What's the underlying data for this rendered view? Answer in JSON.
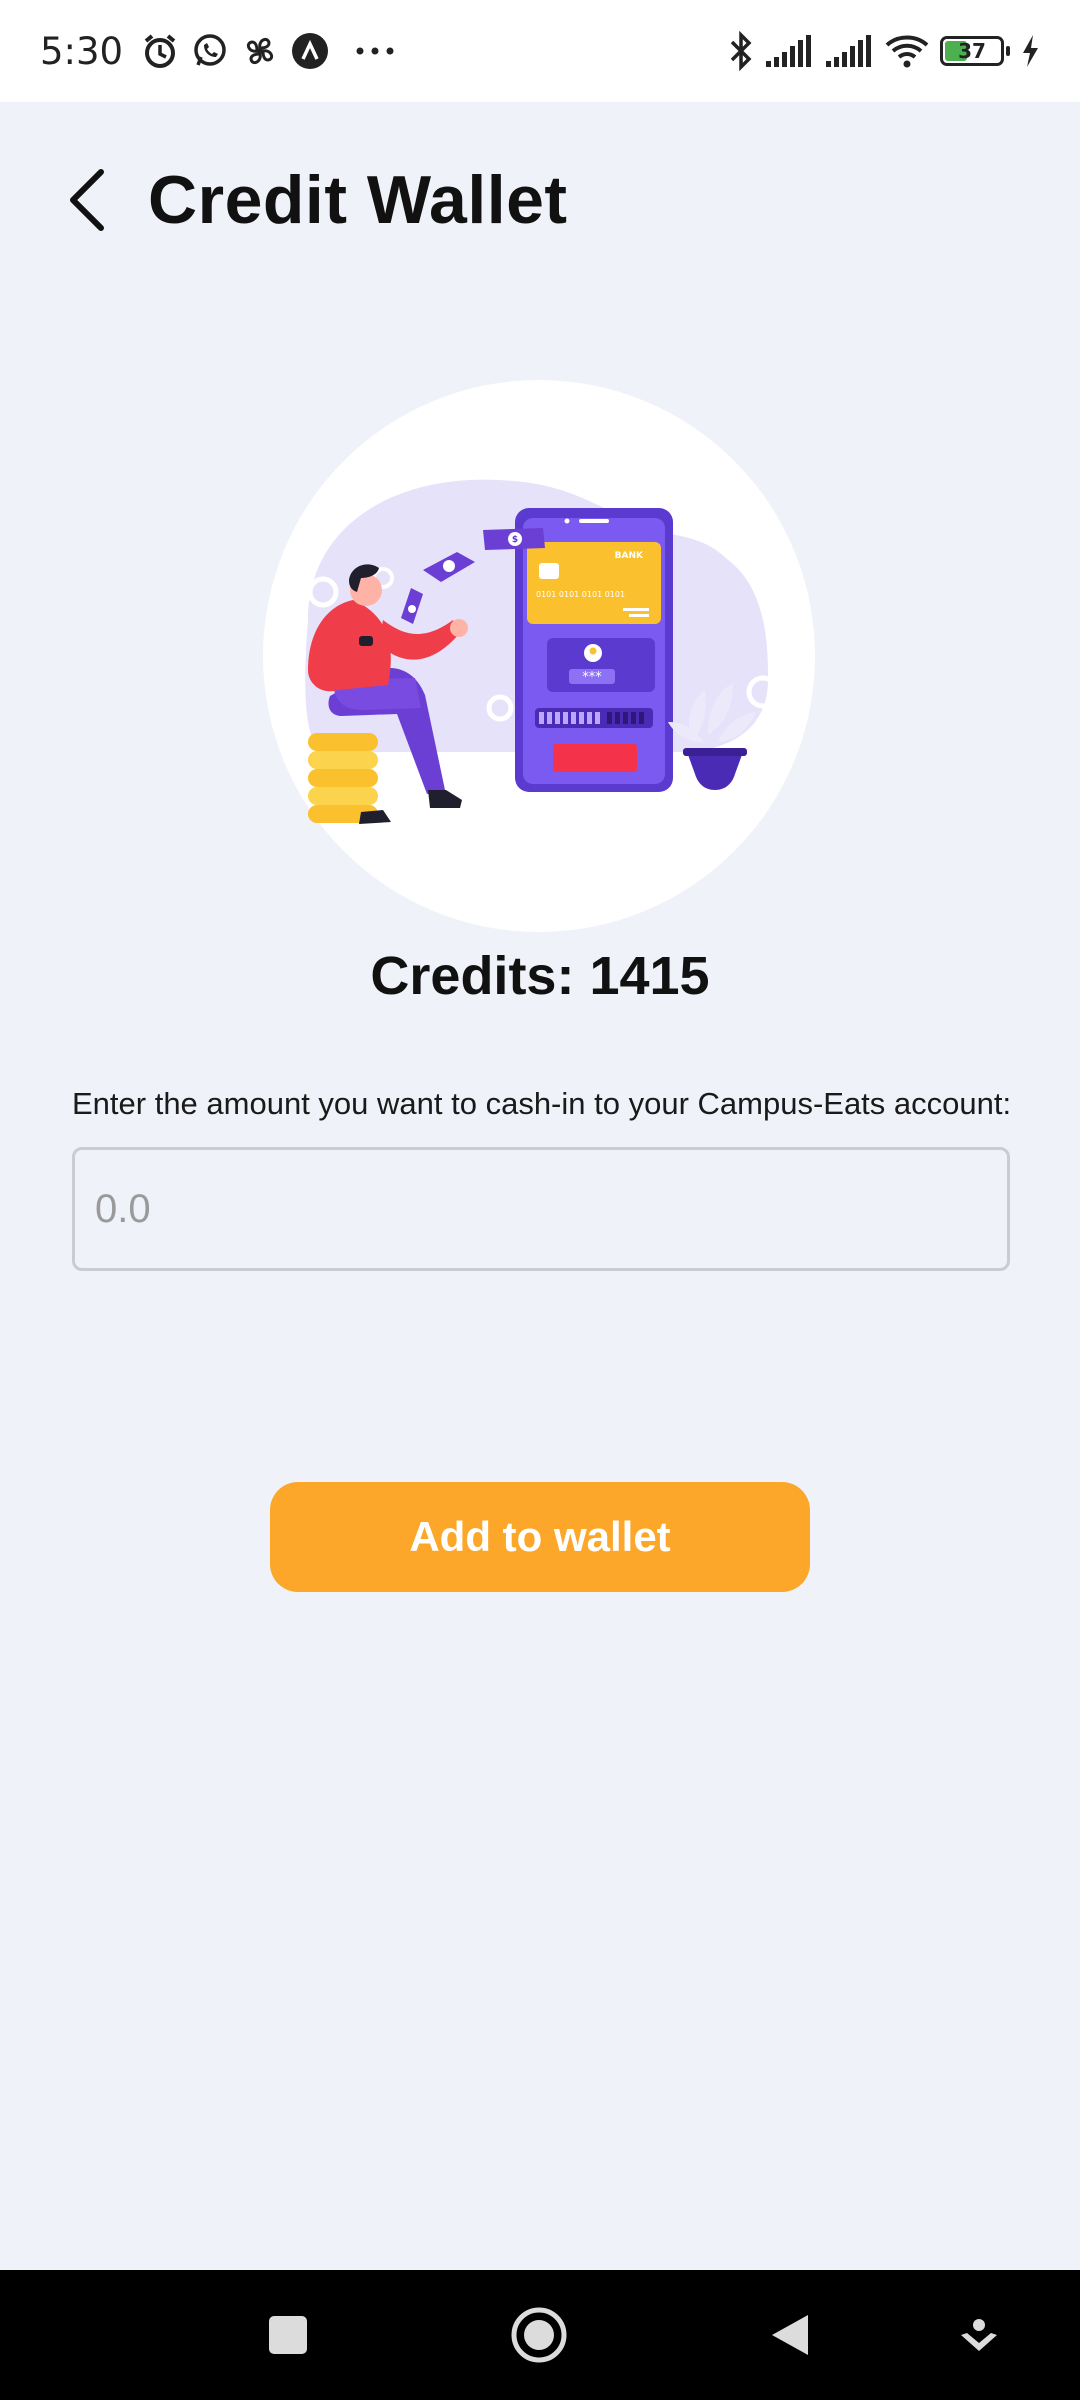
{
  "status_bar": {
    "time": "5:30",
    "battery": "37",
    "icons": [
      "alarm-icon",
      "whatsapp-icon",
      "fan-icon",
      "app-icon",
      "more-dots-icon",
      "bluetooth-icon",
      "signal-icon",
      "signal-icon",
      "wifi-icon",
      "battery-icon",
      "charging-icon"
    ]
  },
  "header": {
    "title": "Credit Wallet",
    "back_icon": "back-arrow-icon"
  },
  "illustration": {
    "name": "wallet-illustration",
    "card_text": "BANK",
    "card_digits": "0101  0101  0101  0101",
    "pin_text": "***"
  },
  "credits": {
    "label": "Credits: 1415"
  },
  "form": {
    "instruction": "Enter the amount you want to cash-in to your Campus-Eats account:",
    "amount_placeholder": "0.0",
    "amount_value": ""
  },
  "actions": {
    "add_label": "Add to wallet"
  },
  "colors": {
    "background": "#eff2f8",
    "accent": "#fca72a",
    "purple": "#6c4ce0",
    "red": "#ef3e4a",
    "yellow": "#fbc02d"
  },
  "nav_bar": {
    "icons": [
      "recents-square-icon",
      "home-circle-icon",
      "back-triangle-icon",
      "assistant-icon"
    ]
  }
}
